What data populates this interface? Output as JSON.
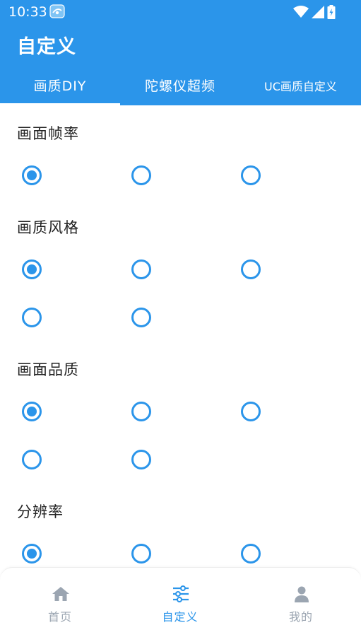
{
  "status_bar": {
    "time": "10:33"
  },
  "appbar": {
    "title": "自定义"
  },
  "tabs": [
    {
      "label": "画质DIY",
      "selected": true
    },
    {
      "label": "陀螺仪超频",
      "selected": false
    },
    {
      "label": "UC画质自定义",
      "selected": false
    }
  ],
  "sections": [
    {
      "title": "画面帧率",
      "selected_index": 0,
      "option_count": 3
    },
    {
      "title": "画质风格",
      "selected_index": 0,
      "option_count": 5
    },
    {
      "title": "画面品质",
      "selected_index": 0,
      "option_count": 5
    },
    {
      "title": "分辨率",
      "selected_index": 0,
      "option_count": 3
    }
  ],
  "bottom_nav": [
    {
      "label": "首页",
      "icon": "home-icon",
      "active": false
    },
    {
      "label": "自定义",
      "icon": "sliders-icon",
      "active": true
    },
    {
      "label": "我的",
      "icon": "person-icon",
      "active": false
    }
  ],
  "colors": {
    "primary": "#2b95ea",
    "nav_inactive": "#9ba5b1",
    "text": "#222222"
  }
}
